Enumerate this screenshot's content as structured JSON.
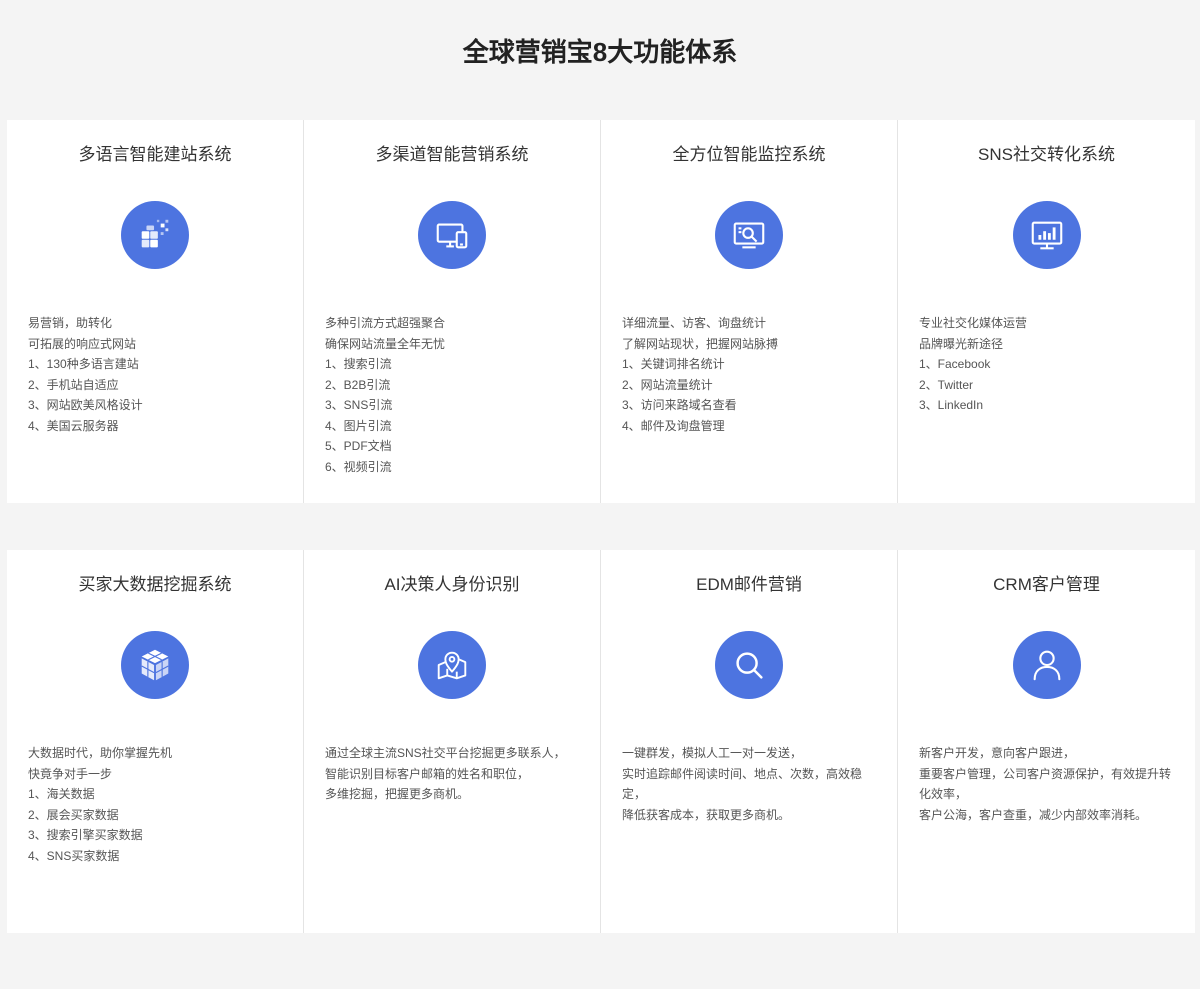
{
  "page_title": "全球营销宝8大功能体系",
  "cards": [
    {
      "title": "多语言智能建站系统",
      "icon": "cubes-icon",
      "lines": [
        "易营销，助转化",
        "可拓展的响应式网站",
        "1、130种多语言建站",
        "2、手机站自适应",
        "3、网站欧美风格设计",
        "4、美国云服务器"
      ]
    },
    {
      "title": "多渠道智能营销系统",
      "icon": "devices-icon",
      "lines": [
        "多种引流方式超强聚合",
        "确保网站流量全年无忧",
        "1、搜索引流",
        "2、B2B引流",
        "3、SNS引流",
        "4、图片引流",
        "5、PDF文档",
        "6、视频引流"
      ]
    },
    {
      "title": "全方位智能监控系统",
      "icon": "monitor-search-icon",
      "lines": [
        "详细流量、访客、询盘统计",
        "了解网站现状，把握网站脉搏",
        "1、关键词排名统计",
        "2、网站流量统计",
        "3、访问来路域名查看",
        "4、邮件及询盘管理"
      ]
    },
    {
      "title": "SNS社交转化系统",
      "icon": "chart-monitor-icon",
      "lines": [
        "专业社交化媒体运营",
        "品牌曝光新途径",
        "1、Facebook",
        "2、Twitter",
        "3、LinkedIn"
      ]
    },
    {
      "title": "买家大数据挖掘系统",
      "icon": "data-cube-icon",
      "lines": [
        "大数据时代，助你掌握先机",
        "快竟争对手一步",
        "1、海关数据",
        "2、展会买家数据",
        "3、搜索引擎买家数据",
        "4、SNS买家数据"
      ]
    },
    {
      "title": "AI决策人身份识别",
      "icon": "map-pin-icon",
      "lines": [
        "通过全球主流SNS社交平台挖掘更多联系人，",
        "智能识别目标客户邮箱的姓名和职位，",
        "多维挖掘，把握更多商机。"
      ]
    },
    {
      "title": "EDM邮件营销",
      "icon": "search-icon",
      "lines": [
        "一键群发，模拟人工一对一发送，",
        "实时追踪邮件阅读时间、地点、次数，高效稳定，",
        "降低获客成本，获取更多商机。"
      ]
    },
    {
      "title": "CRM客户管理",
      "icon": "user-icon",
      "lines": [
        "新客户开发，意向客户跟进，",
        "重要客户管理，公司客户资源保护，有效提升转化效率，",
        "客户公海，客户查重，减少内部效率消耗。"
      ]
    }
  ],
  "colors": {
    "accent": "#4d74e0",
    "background": "#f4f4f4",
    "card": "#ffffff"
  }
}
